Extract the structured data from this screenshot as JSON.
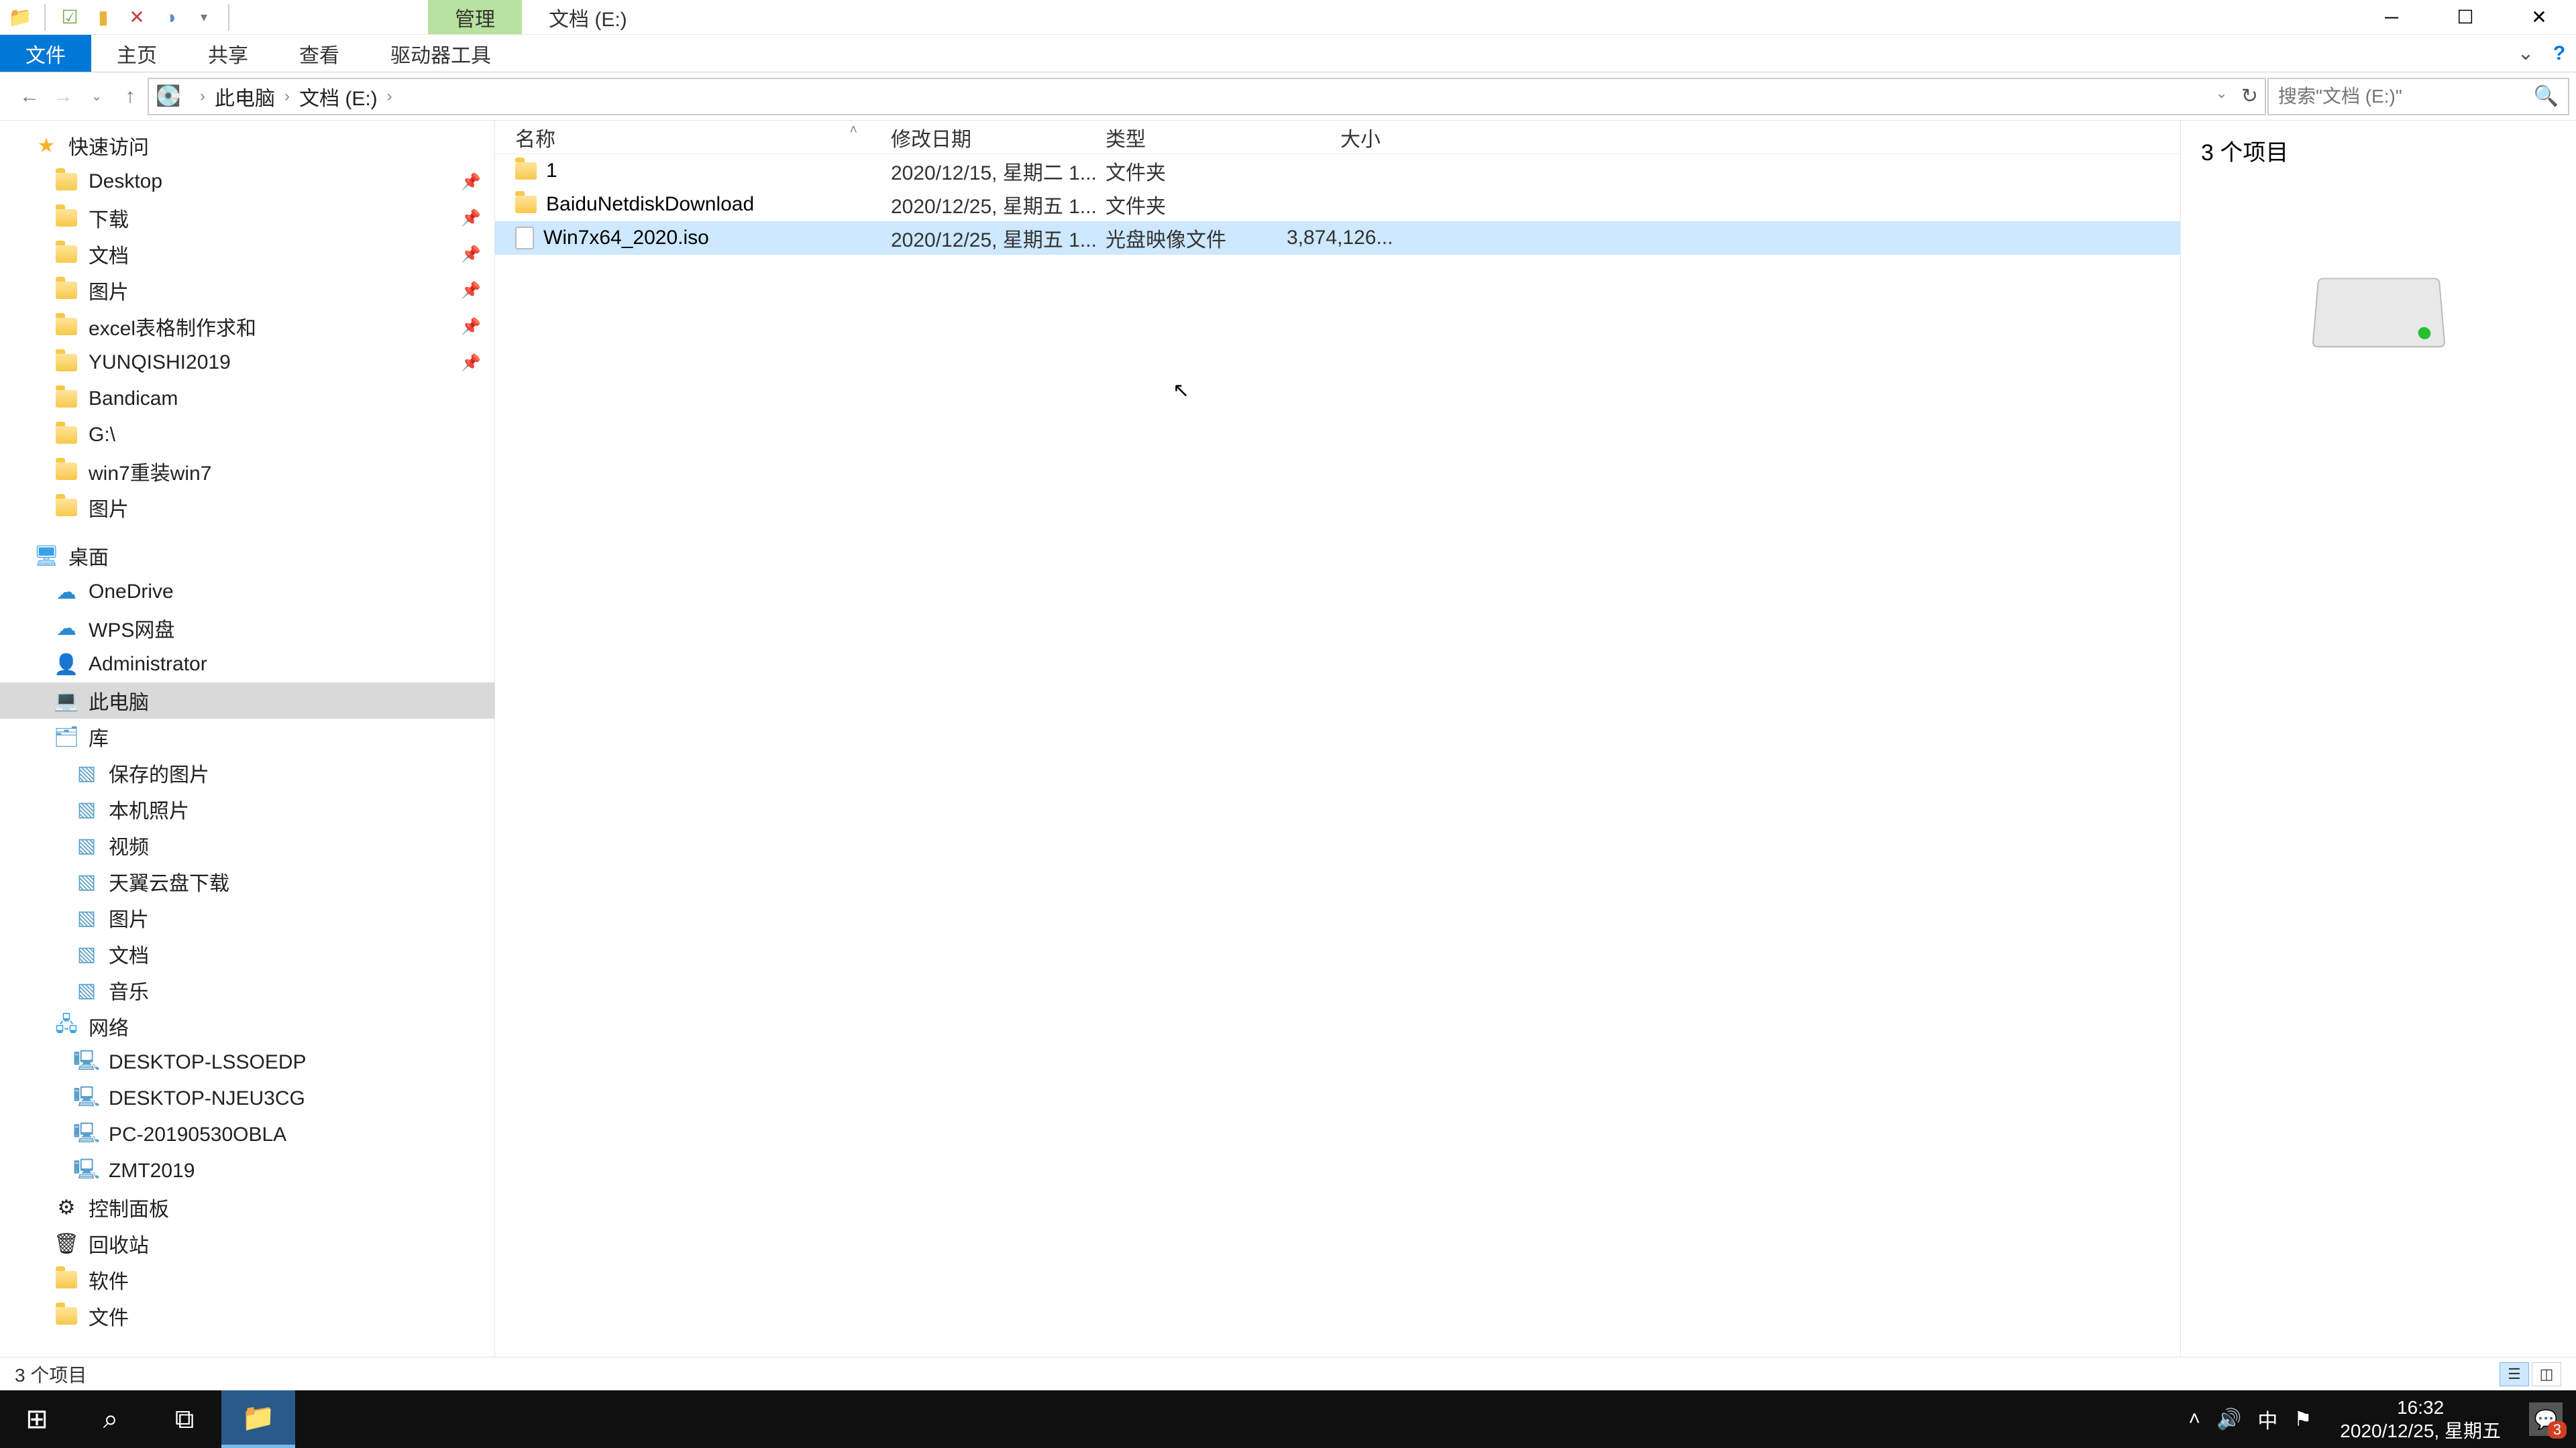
{
  "titlebar": {
    "contextual_tab": "管理",
    "title": "文档 (E:)"
  },
  "ribbon": {
    "file": "文件",
    "tabs": [
      "主页",
      "共享",
      "查看",
      "驱动器工具"
    ]
  },
  "breadcrumb": {
    "root": "此电脑",
    "path": "文档 (E:)"
  },
  "search": {
    "placeholder": "搜索\"文档 (E:)\""
  },
  "sidebar": {
    "quick_access": "快速访问",
    "quick_items": [
      {
        "label": "Desktop",
        "pin": true
      },
      {
        "label": "下载",
        "pin": true
      },
      {
        "label": "文档",
        "pin": true
      },
      {
        "label": "图片",
        "pin": true
      },
      {
        "label": "excel表格制作求和",
        "pin": true
      },
      {
        "label": "YUNQISHI2019",
        "pin": true
      },
      {
        "label": "Bandicam",
        "pin": false
      },
      {
        "label": "G:\\",
        "pin": false
      },
      {
        "label": "win7重装win7",
        "pin": false
      },
      {
        "label": "图片",
        "pin": false
      }
    ],
    "desktop": "桌面",
    "desktop_items": [
      "OneDrive",
      "WPS网盘",
      "Administrator"
    ],
    "this_pc": "此电脑",
    "libraries": "库",
    "library_items": [
      "保存的图片",
      "本机照片",
      "视频",
      "天翼云盘下载",
      "图片",
      "文档",
      "音乐"
    ],
    "network": "网络",
    "network_items": [
      "DESKTOP-LSSOEDP",
      "DESKTOP-NJEU3CG",
      "PC-20190530OBLA",
      "ZMT2019"
    ],
    "control_panel": "控制面板",
    "recycle": "回收站",
    "soft": "软件",
    "files": "文件"
  },
  "columns": {
    "name": "名称",
    "date": "修改日期",
    "type": "类型",
    "size": "大小"
  },
  "files": [
    {
      "name": "1",
      "date": "2020/12/15, 星期二 1...",
      "type": "文件夹",
      "size": "",
      "icon": "folder",
      "selected": false
    },
    {
      "name": "BaiduNetdiskDownload",
      "date": "2020/12/25, 星期五 1...",
      "type": "文件夹",
      "size": "",
      "icon": "folder",
      "selected": false
    },
    {
      "name": "Win7x64_2020.iso",
      "date": "2020/12/25, 星期五 1...",
      "type": "光盘映像文件",
      "size": "3,874,126...",
      "icon": "file",
      "selected": true
    }
  ],
  "preview": {
    "title": "3 个项目"
  },
  "statusbar": {
    "text": "3 个项目"
  },
  "taskbar": {
    "clock_time": "16:32",
    "clock_date": "2020/12/25, 星期五",
    "ime": "中",
    "notif_count": "3"
  }
}
